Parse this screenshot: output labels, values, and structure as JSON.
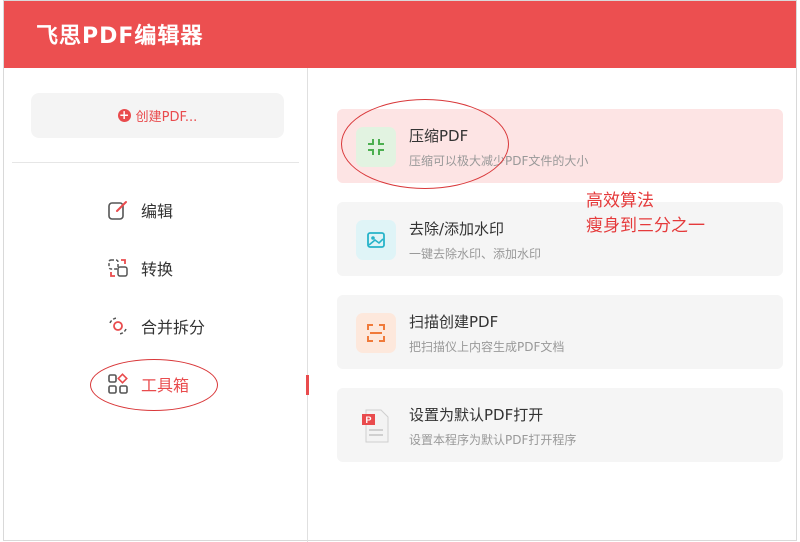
{
  "app": {
    "title": "飞思PDF编辑器"
  },
  "sidebar": {
    "create_label": "创建PDF...",
    "items": [
      {
        "label": "编辑",
        "icon": "edit-icon"
      },
      {
        "label": "转换",
        "icon": "convert-icon"
      },
      {
        "label": "合并拆分",
        "icon": "merge-split-icon"
      },
      {
        "label": "工具箱",
        "icon": "toolbox-icon",
        "active": true
      }
    ]
  },
  "tools": [
    {
      "title": "压缩PDF",
      "desc": "压缩可以极大减少PDF文件的大小",
      "icon": "compress-icon",
      "color": "#4caf50"
    },
    {
      "title": "去除/添加水印",
      "desc": "一键去除水印、添加水印",
      "icon": "watermark-icon",
      "color": "#26b3c9"
    },
    {
      "title": "扫描创建PDF",
      "desc": "把扫描仪上内容生成PDF文档",
      "icon": "scan-icon",
      "color": "#f07a3a"
    },
    {
      "title": "设置为默认PDF打开",
      "desc": "设置本程序为默认PDF打开程序",
      "icon": "pdf-file-icon",
      "color": "#e94b4d"
    }
  ],
  "annotation": {
    "line1": "高效算法",
    "line2": "瘦身到三分之一"
  },
  "colors": {
    "brand": "#ec4f50",
    "accent": "#e94b4d",
    "annotation": "#d9383a"
  }
}
